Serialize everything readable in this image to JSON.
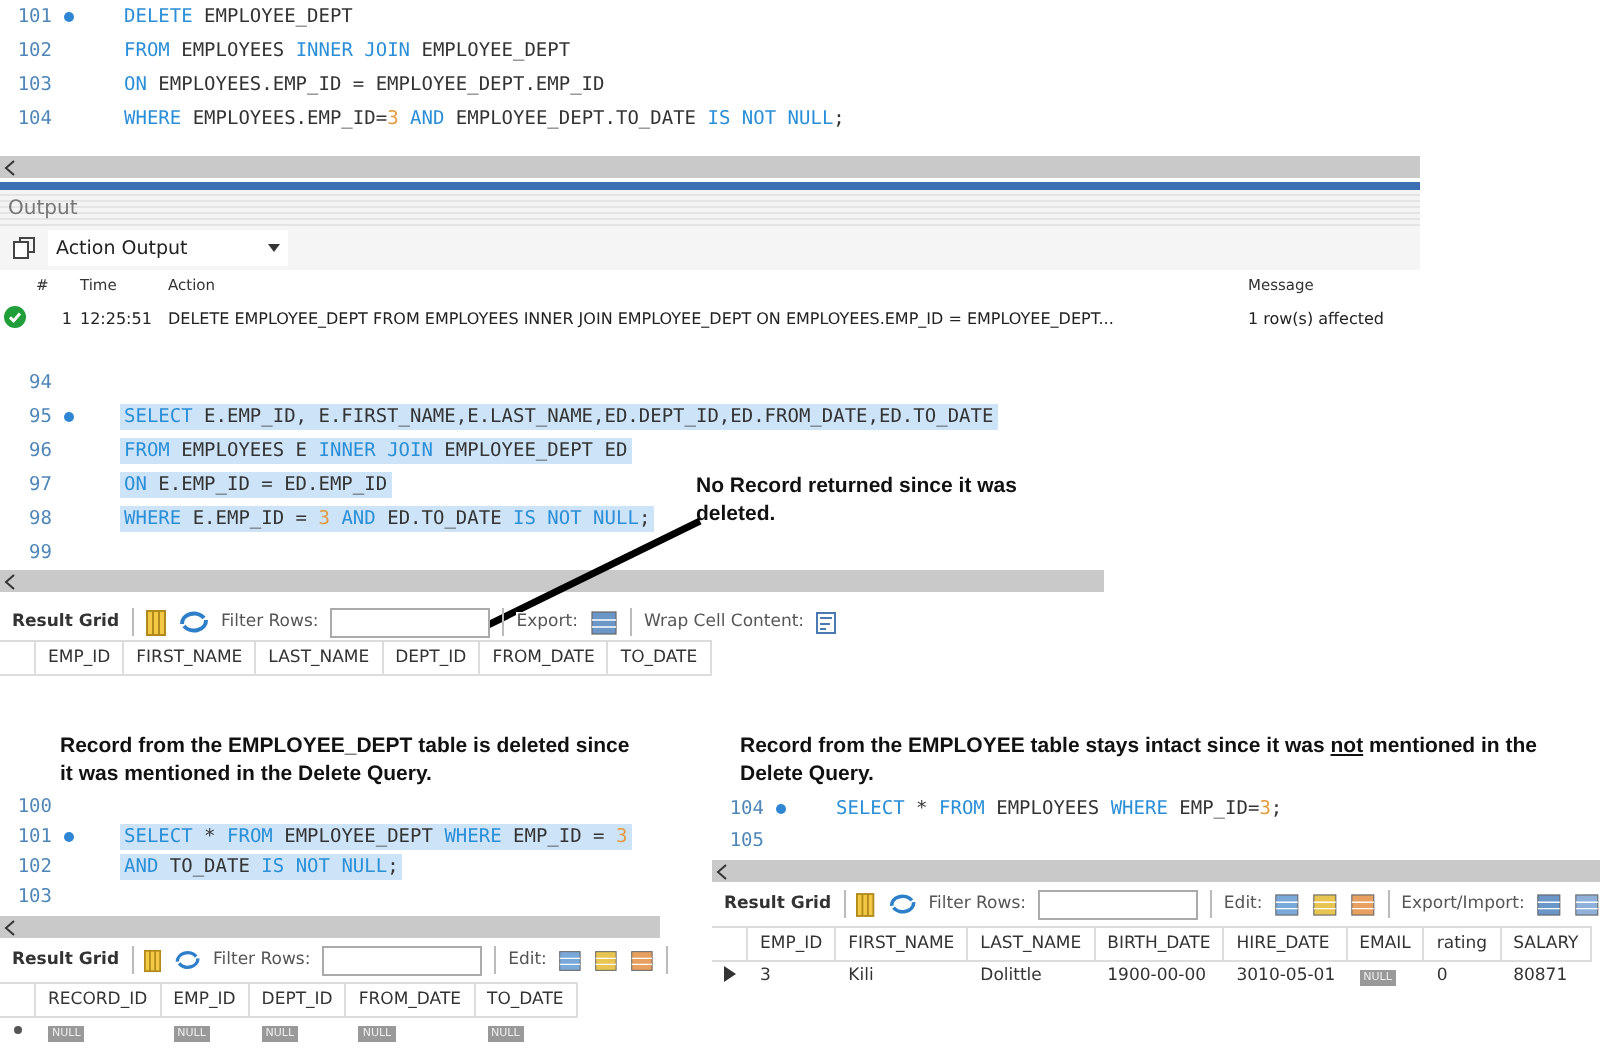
{
  "delete_editor": {
    "lines": [
      {
        "num": "101",
        "dot": true,
        "tokens": [
          {
            "kind": "keyword",
            "text": "DELETE"
          },
          {
            "kind": "plain",
            "text": " EMPLOYEE_DEPT"
          }
        ]
      },
      {
        "num": "102",
        "dot": false,
        "tokens": [
          {
            "kind": "keyword",
            "text": "FROM"
          },
          {
            "kind": "plain",
            "text": " EMPLOYEES "
          },
          {
            "kind": "keyword",
            "text": "INNER JOIN"
          },
          {
            "kind": "plain",
            "text": " EMPLOYEE_DEPT"
          }
        ]
      },
      {
        "num": "103",
        "dot": false,
        "tokens": [
          {
            "kind": "keyword",
            "text": "ON"
          },
          {
            "kind": "plain",
            "text": " EMPLOYEES.EMP_ID = EMPLOYEE_DEPT.EMP_ID"
          }
        ]
      },
      {
        "num": "104",
        "dot": false,
        "tokens": [
          {
            "kind": "keyword",
            "text": "WHERE"
          },
          {
            "kind": "plain",
            "text": " EMPLOYEES.EMP_ID="
          },
          {
            "kind": "number",
            "text": "3"
          },
          {
            "kind": "keyword",
            "text": " AND"
          },
          {
            "kind": "plain",
            "text": " EMPLOYEE_DEPT.TO_DATE "
          },
          {
            "kind": "keyword",
            "text": "IS NOT NULL"
          },
          {
            "kind": "plain",
            "text": ";"
          }
        ]
      }
    ]
  },
  "output": {
    "title": "Output",
    "selector": "Action Output",
    "columns": [
      "#",
      "Time",
      "Action",
      "Message"
    ],
    "rows": [
      {
        "kind": "success",
        "num": "1",
        "time": "12:25:51",
        "action": "DELETE EMPLOYEE_DEPT FROM EMPLOYEES INNER JOIN EMPLOYEE_DEPT  ON EMPLOYEES.EMP_ID = EMPLOYEE_DEPT...",
        "message": "1 row(s) affected"
      }
    ]
  },
  "select_section": {
    "editor": {
      "lines": [
        {
          "num": "94",
          "dot": false
        },
        {
          "num": "95",
          "dot": true,
          "selected": true,
          "tokens": [
            {
              "kind": "keyword",
              "text": "SELECT"
            },
            {
              "kind": "plain",
              "text": " E.EMP_ID, E.FIRST_NAME,E.LAST_NAME,ED.DEPT_ID,ED.FROM_DATE,ED.TO_DATE"
            }
          ]
        },
        {
          "num": "96",
          "dot": false,
          "selected": true,
          "tokens": [
            {
              "kind": "keyword",
              "text": "FROM"
            },
            {
              "kind": "plain",
              "text": " EMPLOYEES E "
            },
            {
              "kind": "keyword",
              "text": "INNER JOIN"
            },
            {
              "kind": "plain",
              "text": " EMPLOYEE_DEPT ED"
            }
          ]
        },
        {
          "num": "97",
          "dot": false,
          "selected": true,
          "tokens": [
            {
              "kind": "keyword",
              "text": "ON"
            },
            {
              "kind": "plain",
              "text": " E.EMP_ID = ED.EMP_ID"
            }
          ]
        },
        {
          "num": "98",
          "dot": false,
          "selected": true,
          "tokens": [
            {
              "kind": "keyword",
              "text": "WHERE"
            },
            {
              "kind": "plain",
              "text": " E.EMP_ID = "
            },
            {
              "kind": "number",
              "text": "3"
            },
            {
              "kind": "keyword",
              "text": " AND"
            },
            {
              "kind": "plain",
              "text": " ED.TO_DATE "
            },
            {
              "kind": "keyword",
              "text": "IS NOT NULL"
            },
            {
              "kind": "plain",
              "text": ";"
            }
          ]
        },
        {
          "num": "99",
          "dot": false
        }
      ]
    },
    "note": [
      {
        "text": "No Record returned since it was deleted.",
        "underline": false
      }
    ],
    "toolbar": {
      "title": "Result Grid",
      "filter_label": "Filter Rows:",
      "export_label": "Export:",
      "wrap_label": "Wrap Cell Content:"
    },
    "grid": {
      "columns": [
        "EMP_ID",
        "FIRST_NAME",
        "LAST_NAME",
        "DEPT_ID",
        "FROM_DATE",
        "TO_DATE"
      ]
    }
  },
  "left_section": {
    "note": [
      {
        "text": "Record from the EMPLOYEE_DEPT table is deleted since it was mentioned in the Delete Query.",
        "underline": false
      }
    ],
    "editor": {
      "lines": [
        {
          "num": "100",
          "dot": false
        },
        {
          "num": "101",
          "dot": true,
          "selected": true,
          "tokens": [
            {
              "kind": "keyword",
              "text": "SELECT"
            },
            {
              "kind": "plain",
              "text": " * "
            },
            {
              "kind": "keyword",
              "text": "FROM"
            },
            {
              "kind": "plain",
              "text": " EMPLOYEE_DEPT "
            },
            {
              "kind": "keyword",
              "text": "WHERE"
            },
            {
              "kind": "plain",
              "text": " EMP_ID = "
            },
            {
              "kind": "number",
              "text": "3"
            }
          ]
        },
        {
          "num": "102",
          "dot": false,
          "selected": true,
          "tokens": [
            {
              "kind": "keyword",
              "text": "AND"
            },
            {
              "kind": "plain",
              "text": " TO_DATE "
            },
            {
              "kind": "keyword",
              "text": "IS NOT NULL"
            },
            {
              "kind": "plain",
              "text": ";"
            }
          ]
        },
        {
          "num": "103",
          "dot": false
        }
      ]
    },
    "toolbar": {
      "title": "Result Grid",
      "filter_label": "Filter Rows:",
      "edit_label": "Edit:"
    },
    "grid": {
      "columns": [
        "RECORD_ID",
        "EMP_ID",
        "DEPT_ID",
        "FROM_DATE",
        "TO_DATE"
      ],
      "rows": [
        {
          "kind": "new",
          "cells": [
            {
              "kind": "null",
              "text": "NULL"
            },
            {
              "kind": "null",
              "text": "NULL"
            },
            {
              "kind": "null",
              "text": "NULL"
            },
            {
              "kind": "null",
              "text": "NULL"
            },
            {
              "kind": "null",
              "text": "NULL"
            }
          ]
        }
      ]
    }
  },
  "right_section": {
    "note": [
      {
        "text": "Record from the EMPLOYEE table stays intact since it was ",
        "underline": false
      },
      {
        "text": "not",
        "underline": true
      },
      {
        "text": " mentioned in the Delete Query.",
        "underline": false
      }
    ],
    "editor": {
      "lines": [
        {
          "num": "104",
          "dot": true,
          "tokens": [
            {
              "kind": "keyword",
              "text": "SELECT"
            },
            {
              "kind": "plain",
              "text": " * "
            },
            {
              "kind": "keyword",
              "text": "FROM"
            },
            {
              "kind": "plain",
              "text": " EMPLOYEES "
            },
            {
              "kind": "keyword",
              "text": "WHERE"
            },
            {
              "kind": "plain",
              "text": " EMP_ID="
            },
            {
              "kind": "number",
              "text": "3"
            },
            {
              "kind": "plain",
              "text": ";"
            }
          ]
        },
        {
          "num": "105",
          "dot": false
        }
      ]
    },
    "toolbar": {
      "title": "Result Grid",
      "filter_label": "Filter Rows:",
      "edit_label": "Edit:",
      "export_label": "Export/Import:"
    },
    "grid": {
      "columns": [
        "EMP_ID",
        "FIRST_NAME",
        "LAST_NAME",
        "BIRTH_DATE",
        "HIRE_DATE",
        "EMAIL",
        "rating",
        "SALARY"
      ],
      "rows": [
        {
          "kind": "current",
          "cells": [
            {
              "kind": "plain",
              "text": "3"
            },
            {
              "kind": "plain",
              "text": "Kili"
            },
            {
              "kind": "plain",
              "text": "Dolittle"
            },
            {
              "kind": "plain",
              "text": "1900-00-00"
            },
            {
              "kind": "plain",
              "text": "3010-05-01"
            },
            {
              "kind": "null",
              "text": "NULL"
            },
            {
              "kind": "plain",
              "text": "0"
            },
            {
              "kind": "plain",
              "text": "80871"
            }
          ]
        }
      ]
    }
  }
}
